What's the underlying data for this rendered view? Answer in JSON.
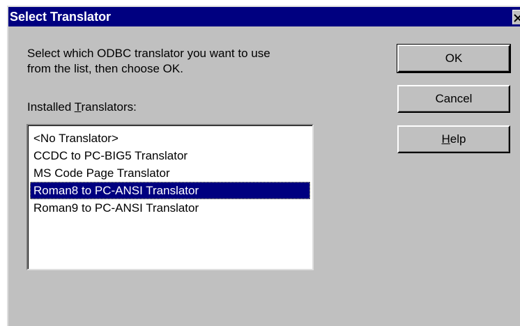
{
  "window": {
    "title": "Select Translator",
    "close_glyph": "✕"
  },
  "instruction": {
    "line1": "Select which ODBC translator you want to use",
    "line2": "from the list, then choose OK."
  },
  "list": {
    "label_pre": "Installed ",
    "label_accel": "T",
    "label_post": "ranslators:",
    "items": [
      "<No Translator>",
      "CCDC to PC-BIG5 Translator",
      "MS Code Page Translator",
      "Roman8 to PC-ANSI Translator",
      "Roman9 to PC-ANSI Translator"
    ],
    "selected": "Roman8 to PC-ANSI Translator"
  },
  "buttons": {
    "ok": "OK",
    "cancel": "Cancel",
    "help_accel": "H",
    "help_rest": "elp"
  },
  "colors": {
    "titlebar": "#000080",
    "face": "#c0c0c0",
    "selection": "#000080"
  }
}
